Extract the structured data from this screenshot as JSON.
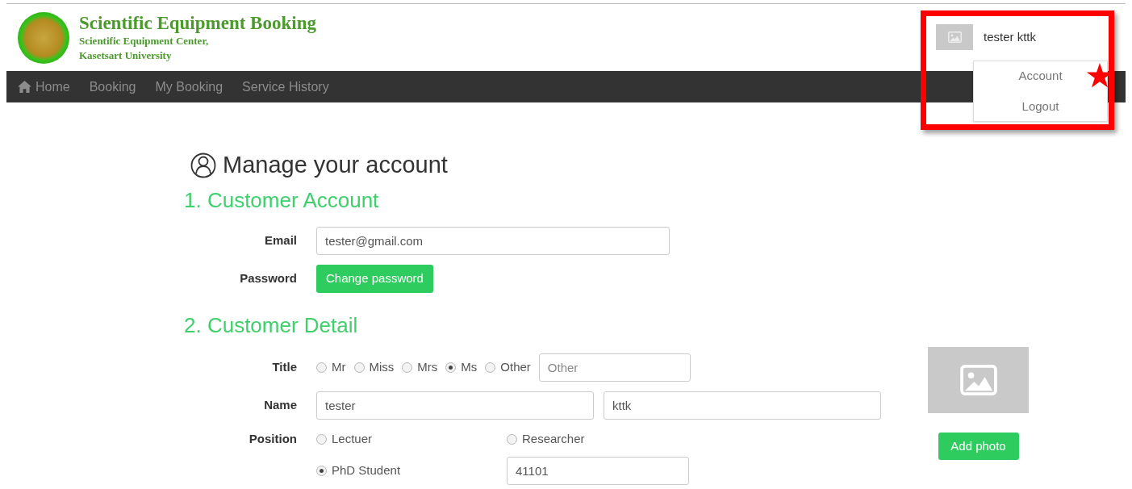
{
  "header": {
    "title": "Scientific Equipment Booking",
    "subtitle_lines": [
      "Scientific Equipment Center,",
      "Kasetsart University"
    ]
  },
  "nav": [
    {
      "kind": "home",
      "label": "Home"
    },
    {
      "kind": "link",
      "label": "Booking"
    },
    {
      "kind": "link",
      "label": "My Booking"
    },
    {
      "kind": "link",
      "label": "Service History"
    }
  ],
  "user_menu": {
    "name": "tester kttk",
    "expanded": true,
    "highlighted": true,
    "items": [
      {
        "label": "Account",
        "starred": true
      },
      {
        "label": "Logout",
        "starred": false
      }
    ]
  },
  "page_title": "Manage your account",
  "account_section": {
    "heading": "1. Customer Account",
    "email_label": "Email",
    "email": "tester@gmail.com",
    "password_label": "Password",
    "password_button": "Change password"
  },
  "detail_section": {
    "heading": "2. Customer Detail",
    "title_label": "Title",
    "title_options": [
      {
        "label": "Mr",
        "selected": false
      },
      {
        "label": "Miss",
        "selected": false
      },
      {
        "label": "Mrs",
        "selected": false
      },
      {
        "label": "Ms",
        "selected": true
      },
      {
        "label": "Other",
        "selected": false
      }
    ],
    "other_placeholder": "Other",
    "name_label": "Name",
    "first_name": "tester",
    "last_name": "kttk",
    "position_label": "Position",
    "position_options": [
      {
        "label": "Lectuer",
        "selected": false
      },
      {
        "label": "Researcher",
        "selected": false
      },
      {
        "label": "PhD Student",
        "selected": true,
        "value": "41101"
      }
    ],
    "photo_button": "Add photo"
  }
}
